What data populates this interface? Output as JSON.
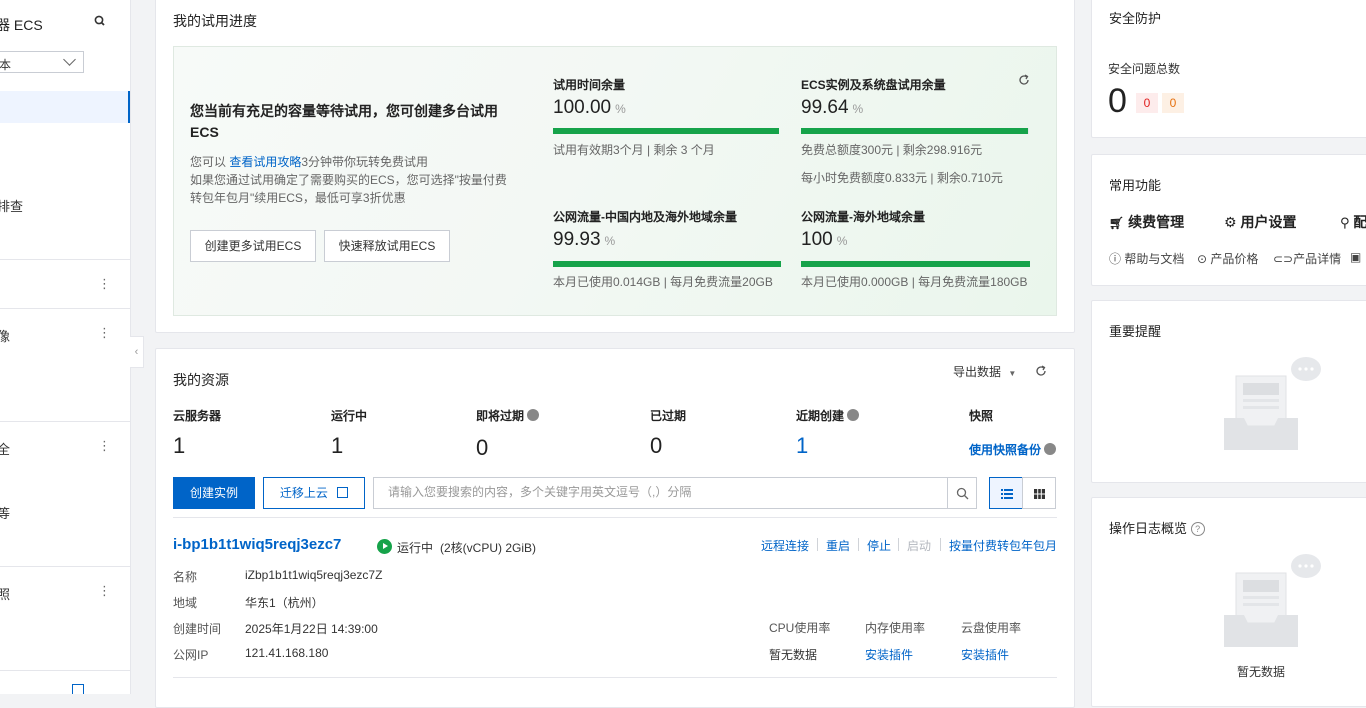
{
  "sidebar": {
    "title": "器 ECS",
    "select_value": "本",
    "items": [
      "排查",
      "像",
      "全",
      "等",
      "照"
    ]
  },
  "trial": {
    "section_title": "我的试用进度",
    "heading": "您当前有充足的容量等待试用，您可创建多台试用ECS",
    "desc_prefix": "您可以",
    "desc_link": "查看试用攻略",
    "desc_suffix": "3分钟带你玩转免费试用",
    "desc_line2": "如果您通过试用确定了需要购买的ECS，您可选择\"按量付费",
    "desc_line3": "转包年包月\"续用ECS，最低可享3折优惠",
    "btn_create_more": "创建更多试用ECS",
    "btn_release": "快速释放试用ECS",
    "metrics": [
      {
        "label": "试用时间余量",
        "value": "100.00",
        "unit": "%",
        "fill": 1.0,
        "sub": "试用有效期3个月  |  剩余 3 个月"
      },
      {
        "label": "ECS实例及系统盘试用余量",
        "value": "99.64",
        "unit": "%",
        "fill": 0.9964,
        "sub": "免费总额度300元  |  剩余298.916元",
        "sub2": "每小时免费额度0.833元  |  剩余0.710元"
      },
      {
        "label": "公网流量-中国内地及海外地域余量",
        "value": "99.93",
        "unit": "%",
        "fill": 0.9993,
        "sub": "本月已使用0.014GB | 每月免费流量20GB"
      },
      {
        "label": "公网流量-海外地域余量",
        "value": "100",
        "unit": "%",
        "fill": 1.0,
        "sub": "本月已使用0.000GB | 每月免费流量180GB"
      }
    ]
  },
  "resources": {
    "section_title": "我的资源",
    "export_label": "导出数据",
    "stats": [
      {
        "label": "云服务器",
        "value": "1"
      },
      {
        "label": "运行中",
        "value": "1"
      },
      {
        "label": "即将过期",
        "value": "0"
      },
      {
        "label": "已过期",
        "value": "0"
      },
      {
        "label": "近期创建",
        "value": "1"
      }
    ],
    "snapshot_label": "快照",
    "snapshot_link": "使用快照备份",
    "btn_create": "创建实例",
    "btn_migrate": "迁移上云",
    "search_placeholder": "请输入您要搜索的内容，多个关键字用英文逗号（,）分隔"
  },
  "instance": {
    "id": "i-bp1b1t1wiq5reqj3ezc7",
    "status": "运行中",
    "spec": "(2核(vCPU) 2GiB)",
    "actions": [
      "远程连接",
      "重启",
      "停止",
      "启动",
      "按量付费转包年包月"
    ],
    "fields": [
      {
        "k": "名称",
        "v": "iZbp1b1t1wiq5reqj3ezc7Z"
      },
      {
        "k": "地域",
        "v": "华东1（杭州）"
      },
      {
        "k": "创建时间",
        "v": "2025年1月22日 14:39:00"
      },
      {
        "k": "公网IP",
        "v": "121.41.168.180"
      }
    ],
    "monitor_headers": [
      "CPU使用率",
      "内存使用率",
      "云盘使用率"
    ],
    "monitor_values": [
      "暂无数据",
      "安装插件",
      "安装插件"
    ]
  },
  "security": {
    "title": "安全防护",
    "label": "安全问题总数",
    "total": "0",
    "badge1": "0",
    "badge2": "0"
  },
  "functions": {
    "title": "常用功能",
    "items": [
      "续费管理",
      "用户设置",
      "配"
    ],
    "links": [
      "帮助与文档",
      "产品价格",
      "产品详情"
    ]
  },
  "reminder": {
    "title": "重要提醒"
  },
  "oplog": {
    "title": "操作日志概览",
    "empty": "暂无数据"
  },
  "colors": {
    "primary": "#0064c8",
    "success": "#16a34a"
  }
}
